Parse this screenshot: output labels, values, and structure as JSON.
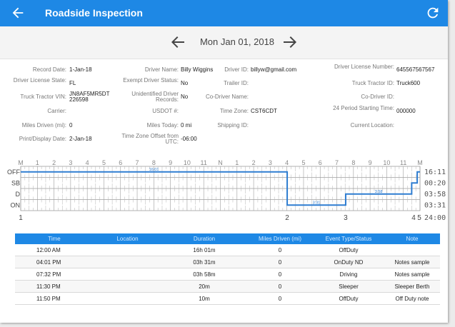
{
  "header": {
    "title": "Roadside Inspection"
  },
  "datebar": {
    "date": "Mon Jan 01, 2018"
  },
  "info": {
    "record_date": {
      "label": "Record Date:",
      "value": "1-Jan-18"
    },
    "driver_name": {
      "label": "Driver Name:",
      "value": "Billy Wiggins"
    },
    "driver_id": {
      "label": "Driver ID:",
      "value": "billyw@gmail.com"
    },
    "driver_license_number": {
      "label": "Driver License Number:",
      "value": "645567567567"
    },
    "driver_license_state": {
      "label": "Driver License State:",
      "value": "FL"
    },
    "exempt_driver_status": {
      "label": "Exempt Driver Status:",
      "value": "No"
    },
    "trailer_id": {
      "label": "Trailer ID:",
      "value": ""
    },
    "truck_tractor_id": {
      "label": "Truck Tractor ID:",
      "value": "Truck600"
    },
    "truck_tractor_vin": {
      "label": "Truck Tractor VIN:",
      "value": "JN8AF5MR5DT226598"
    },
    "unidentified_driver_records": {
      "label": "Unidentified Driver Records:",
      "value": "No"
    },
    "co_driver_name": {
      "label": "Co-Driver Name:",
      "value": ""
    },
    "co_driver_id": {
      "label": "Co-Driver ID:",
      "value": ""
    },
    "carrier": {
      "label": "Carrier:",
      "value": ""
    },
    "usdot": {
      "label": "USDOT #:",
      "value": ""
    },
    "time_zone": {
      "label": "Time Zone:",
      "value": "CST6CDT"
    },
    "period_starting_time": {
      "label": "24 Period Starting Time:",
      "value": "000000"
    },
    "miles_driven": {
      "label": "Miles Driven (mi):",
      "value": "0"
    },
    "miles_today": {
      "label": "Miles Today:",
      "value": "0 mi"
    },
    "shipping_id": {
      "label": "Shipping ID:",
      "value": ""
    },
    "current_location": {
      "label": "Current Location:",
      "value": ""
    },
    "print_display_date": {
      "label": "Print/Display Date:",
      "value": "2-Jan-18"
    },
    "time_zone_offset": {
      "label": "Time Zone Offset from UTC:",
      "value": "-06:00"
    }
  },
  "log_graph": {
    "hour_labels": [
      "M",
      "1",
      "2",
      "3",
      "4",
      "5",
      "6",
      "7",
      "8",
      "9",
      "10",
      "11",
      "N",
      "1",
      "2",
      "3",
      "4",
      "5",
      "6",
      "7",
      "8",
      "9",
      "10",
      "11",
      "M"
    ],
    "status_labels": [
      "OFF",
      "SB",
      "D",
      "ON"
    ],
    "totals": [
      "16:11",
      "00:20",
      "03:58",
      "03:31"
    ],
    "grand_total": "24:00",
    "duration_labels": [
      "16:01",
      "3:31",
      "3:58"
    ],
    "event_numbers": [
      "1",
      "2",
      "3",
      "4",
      "5"
    ],
    "line_color": "#2e7dd1",
    "segments": [
      {
        "status": "OFF",
        "start": 0.0,
        "end": 16.017
      },
      {
        "status": "ON",
        "start": 16.017,
        "end": 19.533
      },
      {
        "status": "D",
        "start": 19.533,
        "end": 23.5
      },
      {
        "status": "SB",
        "start": 23.5,
        "end": 23.833
      },
      {
        "status": "OFF",
        "start": 23.833,
        "end": 24.0
      }
    ]
  },
  "table": {
    "headers": [
      "Time",
      "Location",
      "Duration",
      "Miles Driven (mi)",
      "Event Type/Status",
      "Note"
    ],
    "rows": [
      [
        "12:00 AM",
        "",
        "16h 01m",
        "0",
        "OffDuty",
        ""
      ],
      [
        "04:01 PM",
        "",
        "03h 31m",
        "0",
        "OnDuty ND",
        "Notes sample"
      ],
      [
        "07:32 PM",
        "",
        "03h 58m",
        "0",
        "Driving",
        "Notes sample"
      ],
      [
        "11:30 PM",
        "",
        "20m",
        "0",
        "Sleeper",
        "Sleeper Berth"
      ],
      [
        "11:50 PM",
        "",
        "10m",
        "0",
        "OffDuty",
        "Off Duty note"
      ]
    ]
  },
  "colors": {
    "primary": "#1e88e5",
    "graph_line": "#2e7dd1"
  },
  "icons": {
    "back": "arrow-left-icon",
    "refresh": "refresh-icon",
    "prev": "arrow-left-icon",
    "next": "arrow-right-icon"
  }
}
